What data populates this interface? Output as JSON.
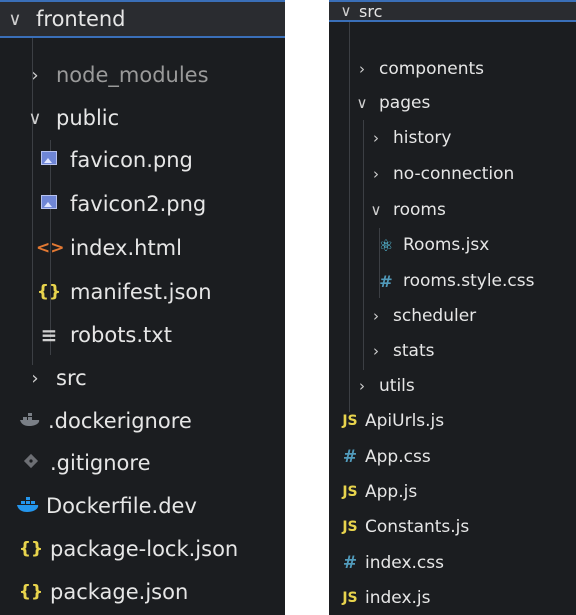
{
  "left_panel": {
    "root_label": "frontend",
    "items": [
      {
        "label": "node_modules",
        "icon": "chevron-right",
        "dim": true
      },
      {
        "label": "public",
        "icon": "chevron-down"
      },
      {
        "label": "favicon.png",
        "icon": "image-icon"
      },
      {
        "label": "favicon2.png",
        "icon": "image-icon"
      },
      {
        "label": "index.html",
        "icon": "html-icon",
        "glyph": "<>"
      },
      {
        "label": "manifest.json",
        "icon": "json-icon",
        "glyph": "{}"
      },
      {
        "label": "robots.txt",
        "icon": "text-icon",
        "glyph": "≡"
      },
      {
        "label": "src",
        "icon": "chevron-right"
      },
      {
        "label": ".dockerignore",
        "icon": "docker-icon"
      },
      {
        "label": ".gitignore",
        "icon": "git-icon"
      },
      {
        "label": "Dockerfile.dev",
        "icon": "docker-icon"
      },
      {
        "label": "package-lock.json",
        "icon": "json-icon",
        "glyph": "{}"
      },
      {
        "label": "package.json",
        "icon": "json-icon",
        "glyph": "{}"
      }
    ]
  },
  "right_panel": {
    "root_label": "src",
    "items": [
      {
        "label": "components",
        "icon": "chevron-right"
      },
      {
        "label": "pages",
        "icon": "chevron-down"
      },
      {
        "label": "history",
        "icon": "chevron-right"
      },
      {
        "label": "no-connection",
        "icon": "chevron-right"
      },
      {
        "label": "rooms",
        "icon": "chevron-down"
      },
      {
        "label": "Rooms.jsx",
        "icon": "react-icon",
        "glyph": "⚛"
      },
      {
        "label": "rooms.style.css",
        "icon": "css-icon",
        "glyph": "#"
      },
      {
        "label": "scheduler",
        "icon": "chevron-right"
      },
      {
        "label": "stats",
        "icon": "chevron-right"
      },
      {
        "label": "utils",
        "icon": "chevron-right"
      },
      {
        "label": "ApiUrls.js",
        "icon": "js-icon",
        "glyph": "JS"
      },
      {
        "label": "App.css",
        "icon": "css-icon",
        "glyph": "#"
      },
      {
        "label": "App.js",
        "icon": "js-icon",
        "glyph": "JS"
      },
      {
        "label": "Constants.js",
        "icon": "js-icon",
        "glyph": "JS"
      },
      {
        "label": "index.css",
        "icon": "css-icon",
        "glyph": "#"
      },
      {
        "label": "index.js",
        "icon": "js-icon",
        "glyph": "JS"
      }
    ]
  },
  "glyphs": {
    "chevron_down": "∨",
    "chevron_right": "›"
  },
  "colors": {
    "background": "#1b1d20",
    "text": "#e6e6e6",
    "selection_border": "#3a6fb8",
    "js": "#e8d44d",
    "css": "#519aba",
    "json": "#e8d44d",
    "html": "#e37933",
    "react": "#61dafb",
    "docker": "#2496ed",
    "image": "#6f86d6"
  }
}
